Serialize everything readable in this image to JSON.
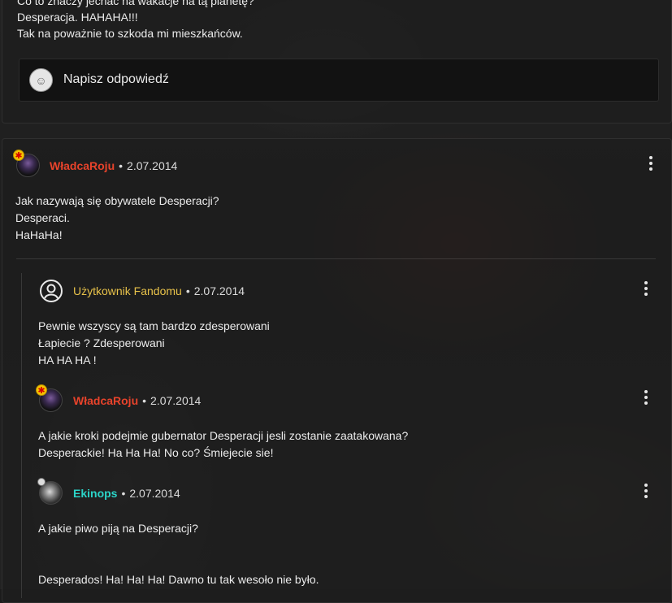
{
  "previous_comment": {
    "lines": [
      "Co to znaczy jechać na wakacje na tą planetę?",
      "Desperacja. HAHAHA!!!",
      "Tak na poważnie to szkoda mi mieszkańców."
    ]
  },
  "reply_box": {
    "placeholder": "Napisz odpowiedź"
  },
  "comment": {
    "author": "WładcaRoju",
    "date": "2.07.2014",
    "lines": [
      "Jak nazywają się obywatele Desperacji?",
      "Desperaci.",
      "HaHaHa!"
    ]
  },
  "replies": [
    {
      "author": "Użytkownik Fandomu",
      "date": "2.07.2014",
      "lines": [
        "Pewnie wszyscy są tam bardzo zdesperowani",
        "Łapiecie ? Zdesperowani",
        "HA HA HA !"
      ]
    },
    {
      "author": "WładcaRoju",
      "date": "2.07.2014",
      "lines": [
        "A jakie kroki podejmie gubernator Desperacji jesli zostanie zaatakowana?",
        "Desperackie!  Ha Ha Ha! No co? Śmiejecie sie!"
      ]
    },
    {
      "author": "Ekinops",
      "date": "2.07.2014",
      "lines": [
        "A jakie piwo piją na Desperacji?",
        "",
        "",
        "Desperados! Ha! Ha! Ha! Dawno tu tak wesoło nie było."
      ]
    }
  ],
  "icons": {
    "reply_avatar": "user-avatar-icon",
    "more": "kebab-menu-icon",
    "anonymous_user": "user-circle-icon",
    "badge": "star-badge-icon"
  },
  "colors": {
    "name_red": "#e8432b",
    "name_yellow": "#e8c24a",
    "name_cyan": "#2bd4c8",
    "badge": "#f5c400"
  }
}
